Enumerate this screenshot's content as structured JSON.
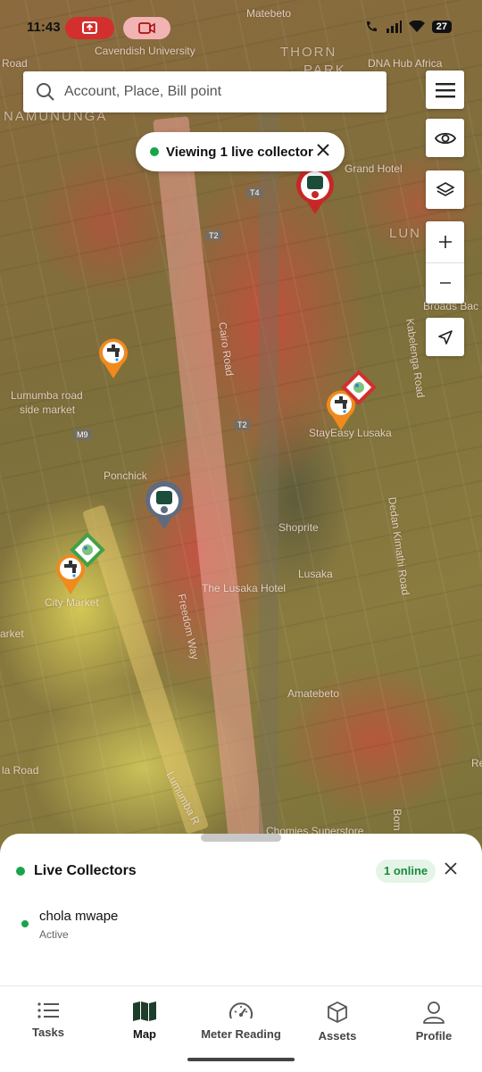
{
  "status_bar": {
    "time": "11:43",
    "battery": "27",
    "icons": [
      "screen-cast-icon",
      "video-call-icon",
      "wifi-call-icon",
      "signal-icon",
      "wifi-icon",
      "battery-icon"
    ]
  },
  "search": {
    "placeholder": "Account, Place, Bill point"
  },
  "map_controls": [
    "menu-icon",
    "eye-icon",
    "layers-icon",
    "zoom-in-icon",
    "zoom-out-icon",
    "locate-icon"
  ],
  "viewing_chip": {
    "label": "Viewing 1 live collector",
    "status_color": "#1ba34a"
  },
  "map": {
    "labels": {
      "matebeto_top": "Matebeto",
      "road_tl": "Road",
      "cavendish": "Cavendish University",
      "thorn": "THORN",
      "park": "PARK",
      "dna_hub": "DNA Hub Africa",
      "namununga": "NAMUNUNGA",
      "grand_hotel": "Grand Hotel",
      "lun": "LUN",
      "broads": "Broads Bac",
      "cairo_road": "Cairo Road",
      "kabelenga": "Kabelenga Road",
      "lumumba_market_1": "Lumumba road",
      "lumumba_market_2": "side market",
      "stayeasy": "StayEasy Lusaka",
      "ponchick": "Ponchick",
      "shoprite": "Shoprite",
      "lusaka": "Lusaka",
      "lusaka_hotel": "The Lusaka Hotel",
      "dedan": "Dedan Kimathi Road",
      "city_market": "City Market",
      "arket": "arket",
      "freedom_way": "Freedom Way",
      "amatebeto": "Amatebeto",
      "la_road": "la Road",
      "lumumba_road": "Lumumba R",
      "chomies": "Chomies Superstore",
      "bom": "Bom",
      "re": "Re"
    },
    "shields": [
      "T4",
      "T2",
      "T2",
      "M9"
    ],
    "marker_colors": {
      "collector_red": "#c62828",
      "collector_gray": "#5f6b80",
      "water_orange": "#f08a1c",
      "billpoint_red": "#d32f2f",
      "billpoint_green": "#43a047"
    }
  },
  "live_collectors": {
    "title": "Live Collectors",
    "online_badge": "1 online",
    "status_color": "#1ba34a",
    "collectors": [
      {
        "name": "chola mwape",
        "status": "Active"
      }
    ]
  },
  "bottom_nav": {
    "active": "Map",
    "items": [
      {
        "label": "Tasks",
        "icon": "tasks-list-icon"
      },
      {
        "label": "Map",
        "icon": "map-icon"
      },
      {
        "label": "Meter Reading",
        "icon": "gauge-icon"
      },
      {
        "label": "Assets",
        "icon": "box-icon"
      },
      {
        "label": "Profile",
        "icon": "profile-icon"
      }
    ]
  }
}
